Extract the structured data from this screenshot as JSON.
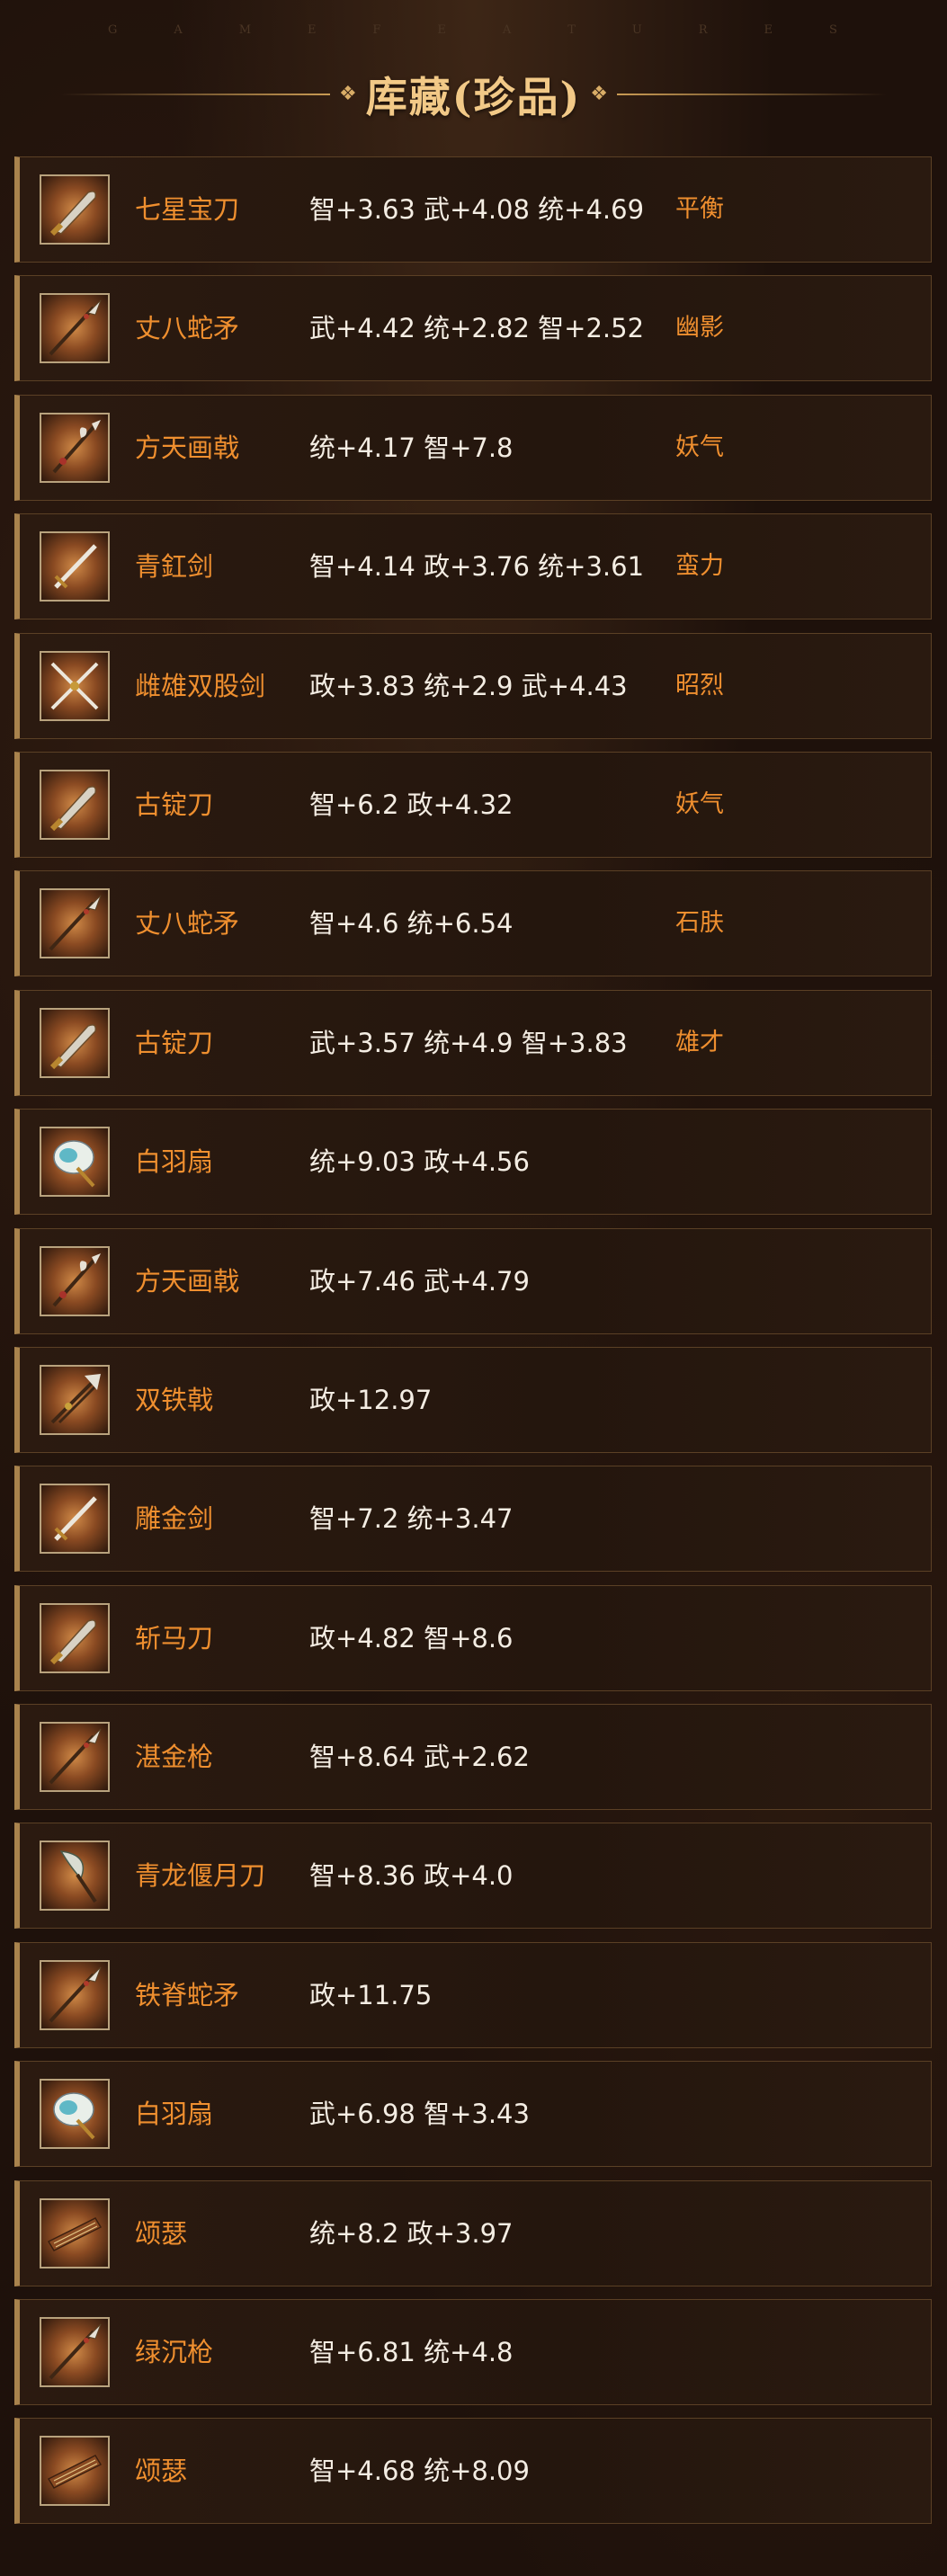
{
  "header": {
    "deco_letters": [
      "G",
      "A",
      "M",
      "E",
      "F",
      "E",
      "A",
      "T",
      "U",
      "R",
      "E",
      "S"
    ],
    "title": "库藏(珍品)"
  },
  "items": [
    {
      "name": "七星宝刀",
      "stats": "智+3.63 武+4.08 统+4.69",
      "trait": "平衡",
      "icon": "blade-icon"
    },
    {
      "name": "丈八蛇矛",
      "stats": "武+4.42 统+2.82 智+2.52",
      "trait": "幽影",
      "icon": "spear-icon"
    },
    {
      "name": "方天画戟",
      "stats": "统+4.17 智+7.8",
      "trait": "妖气",
      "icon": "halberd-icon"
    },
    {
      "name": "青釭剑",
      "stats": "智+4.14 政+3.76 统+3.61",
      "trait": "蛮力",
      "icon": "sword-icon"
    },
    {
      "name": "雌雄双股剑",
      "stats": "政+3.83 统+2.9 武+4.43",
      "trait": "昭烈",
      "icon": "twin-swords-icon"
    },
    {
      "name": "古锭刀",
      "stats": "智+6.2 政+4.32",
      "trait": "妖气",
      "icon": "blade-icon"
    },
    {
      "name": "丈八蛇矛",
      "stats": "智+4.6 统+6.54",
      "trait": "石肤",
      "icon": "spear-icon"
    },
    {
      "name": "古锭刀",
      "stats": "武+3.57 统+4.9 智+3.83",
      "trait": "雄才",
      "icon": "blade-icon"
    },
    {
      "name": "白羽扇",
      "stats": "统+9.03 政+4.56",
      "trait": "",
      "icon": "feather-fan-icon"
    },
    {
      "name": "方天画戟",
      "stats": "政+7.46 武+4.79",
      "trait": "",
      "icon": "halberd-icon"
    },
    {
      "name": "双铁戟",
      "stats": "政+12.97",
      "trait": "",
      "icon": "twin-halberd-icon"
    },
    {
      "name": "雕金剑",
      "stats": "智+7.2 统+3.47",
      "trait": "",
      "icon": "sword-icon"
    },
    {
      "name": "斩马刀",
      "stats": "政+4.82 智+8.6",
      "trait": "",
      "icon": "blade-icon"
    },
    {
      "name": "湛金枪",
      "stats": "智+8.64 武+2.62",
      "trait": "",
      "icon": "spear-icon"
    },
    {
      "name": "青龙偃月刀",
      "stats": "智+8.36 政+4.0",
      "trait": "",
      "icon": "glaive-icon"
    },
    {
      "name": "铁脊蛇矛",
      "stats": "政+11.75",
      "trait": "",
      "icon": "spear-icon"
    },
    {
      "name": "白羽扇",
      "stats": "武+6.98 智+3.43",
      "trait": "",
      "icon": "feather-fan-icon"
    },
    {
      "name": "颂瑟",
      "stats": "统+8.2 政+3.97",
      "trait": "",
      "icon": "zither-icon"
    },
    {
      "name": "绿沉枪",
      "stats": "智+6.81 统+4.8",
      "trait": "",
      "icon": "spear-icon"
    },
    {
      "name": "颂瑟",
      "stats": "智+4.68 统+8.09",
      "trait": "",
      "icon": "zither-icon"
    }
  ]
}
